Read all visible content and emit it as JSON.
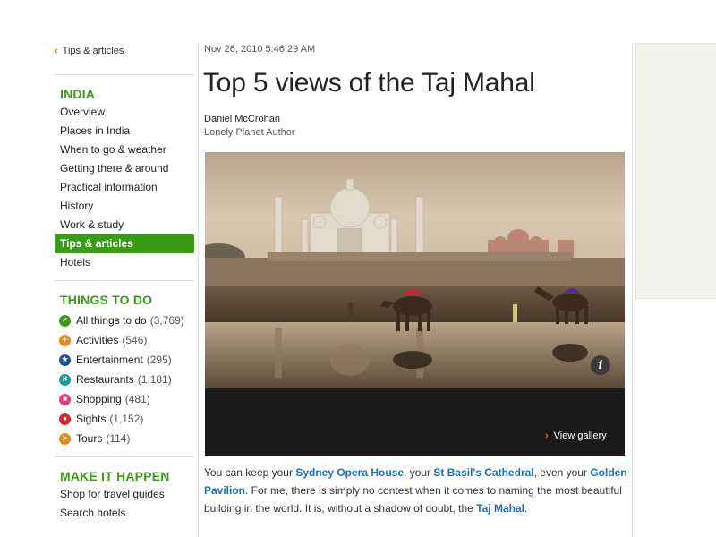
{
  "sidebar": {
    "back_link": "Tips & articles",
    "india": {
      "title": "INDIA",
      "items": [
        {
          "label": "Overview"
        },
        {
          "label": "Places in India"
        },
        {
          "label": "When to go & weather"
        },
        {
          "label": "Getting there & around"
        },
        {
          "label": "Practical information"
        },
        {
          "label": "History"
        },
        {
          "label": "Work & study"
        },
        {
          "label": "Tips & articles",
          "active": true
        },
        {
          "label": "Hotels"
        }
      ]
    },
    "things_to_do": {
      "title": "THINGS TO DO",
      "items": [
        {
          "label": "All things to do",
          "count": "(3,769)",
          "icon": "check-icon",
          "color": "#3a9b16"
        },
        {
          "label": "Activities",
          "count": "(546)",
          "icon": "activity-icon",
          "color": "#e8881a"
        },
        {
          "label": "Entertainment",
          "count": "(295)",
          "icon": "star-icon",
          "color": "#1d4e9a"
        },
        {
          "label": "Restaurants",
          "count": "(1,181)",
          "icon": "cutlery-icon",
          "color": "#1a9a9a"
        },
        {
          "label": "Shopping",
          "count": "(481)",
          "icon": "shopping-bag-icon",
          "color": "#e0407a"
        },
        {
          "label": "Sights",
          "count": "(1,152)",
          "icon": "eye-icon",
          "color": "#d02a2a"
        },
        {
          "label": "Tours",
          "count": "(114)",
          "icon": "tour-icon",
          "color": "#e8881a"
        }
      ]
    },
    "make_it_happen": {
      "title": "MAKE IT HAPPEN",
      "items": [
        {
          "label": "Shop for travel guides"
        },
        {
          "label": "Search hotels"
        }
      ]
    }
  },
  "article": {
    "date": "Nov 26, 2010 5:46:29 AM",
    "title": "Top 5 views of the Taj Mahal",
    "author": "Daniel McCrohan",
    "author_role": "Lonely Planet Author",
    "gallery_link": "View gallery",
    "info_label": "i",
    "body": {
      "t1": "You can keep your ",
      "l1": "Sydney Opera House",
      "t2": ", your ",
      "l2": "St Basil's Cathedral",
      "t3": ", even your ",
      "l3": "Golden Pavilion",
      "t4": ". For me, there is simply no contest when it comes to naming the most beautiful building in the world. It is, without a shadow of doubt, the ",
      "l4": "Taj Mahal",
      "t5": "."
    }
  },
  "colors": {
    "accent_green": "#3a9b16",
    "link_blue": "#1a6fb5",
    "chevron_orange": "#e8701a"
  }
}
